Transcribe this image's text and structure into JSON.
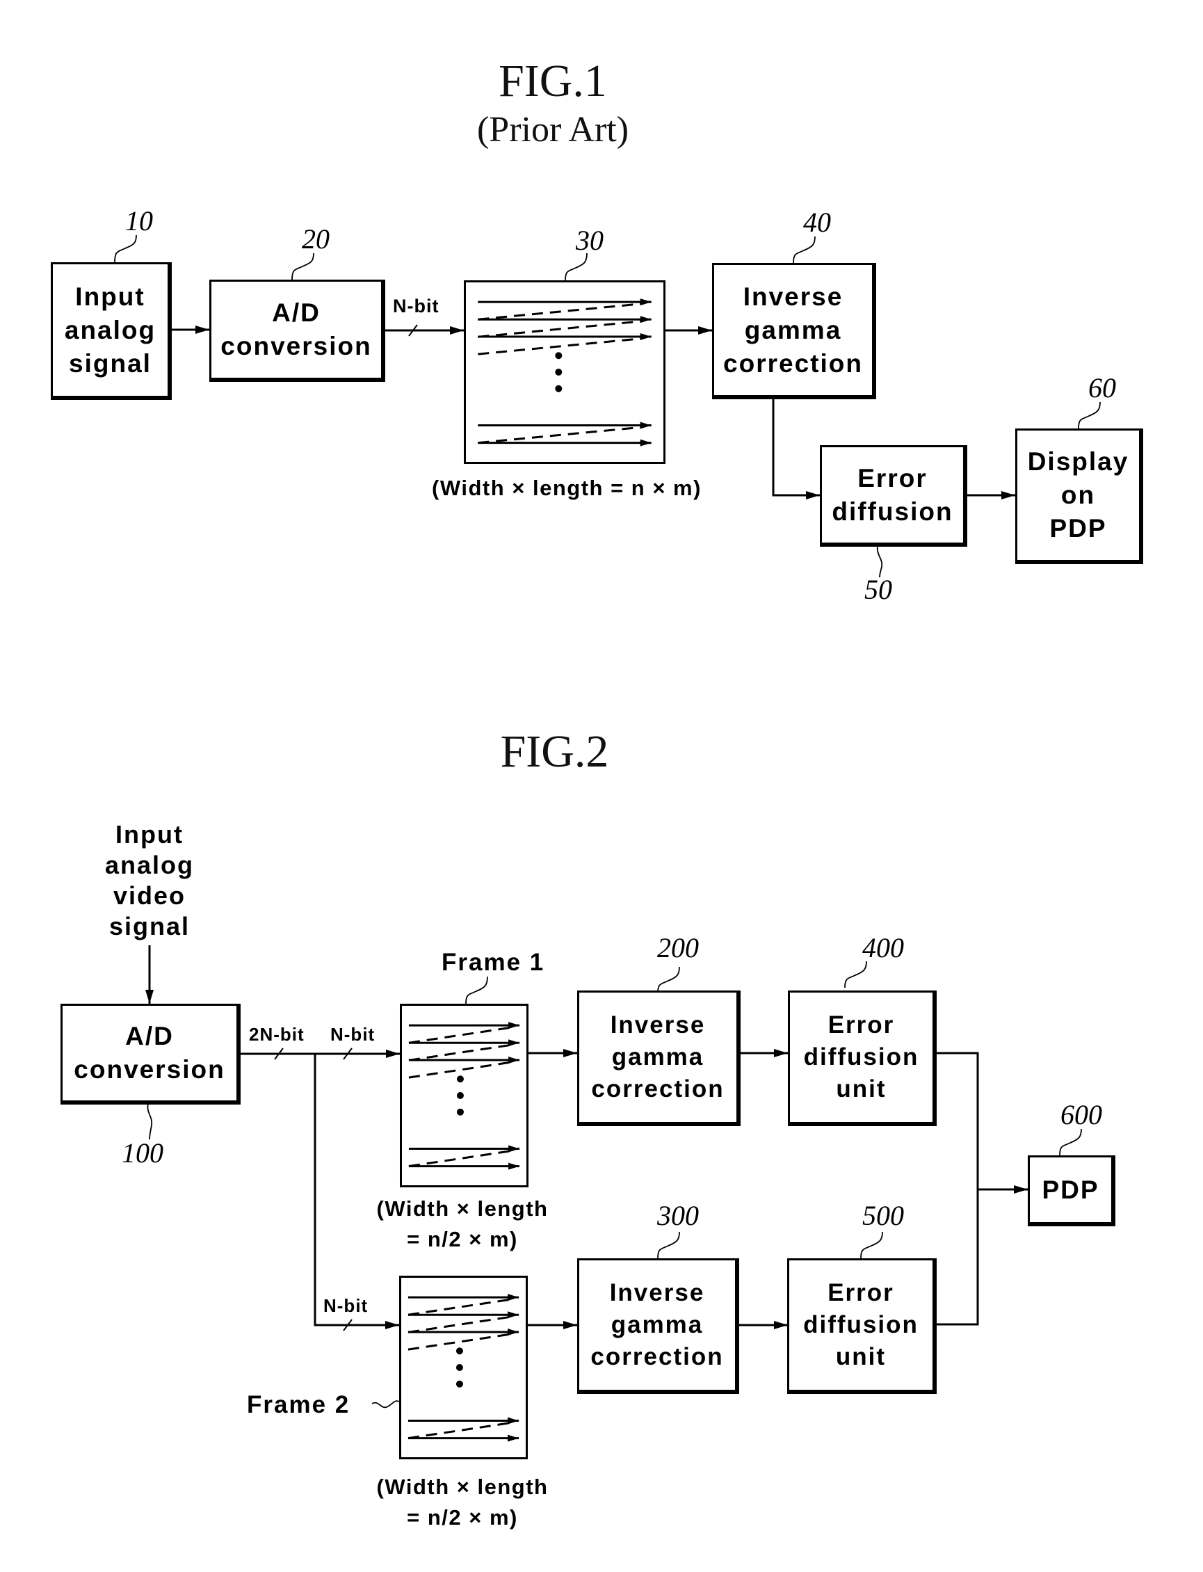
{
  "fig1": {
    "title": "FIG.1",
    "subtitle": "(Prior Art)",
    "blocks": [
      {
        "ref": "10",
        "label": "Input\nanalog\nsignal"
      },
      {
        "ref": "20",
        "label": "A/D\nconversion"
      },
      {
        "ref": "30",
        "label": ""
      },
      {
        "ref": "40",
        "label": "Inverse\ngamma\ncorrection"
      },
      {
        "ref": "50",
        "label": "Error\ndiffusion"
      },
      {
        "ref": "60",
        "label": "Display\non\nPDP"
      }
    ],
    "bus_label": "N-bit",
    "memory_caption": "(Width × length = n × m)"
  },
  "fig2": {
    "title": "FIG.2",
    "input_label": "Input\nanalog\nvideo\nsignal",
    "blocks": [
      {
        "ref": "100",
        "label": "A/D\nconversion"
      },
      {
        "ref": "200",
        "label": "Inverse\ngamma\ncorrection"
      },
      {
        "ref": "300",
        "label": "Inverse\ngamma\ncorrection"
      },
      {
        "ref": "400",
        "label": "Error\ndiffusion\nunit"
      },
      {
        "ref": "500",
        "label": "Error\ndiffusion\nunit"
      },
      {
        "ref": "600",
        "label": "PDP"
      }
    ],
    "bus_labels": {
      "main": "2N-bit",
      "upper": "N-bit",
      "lower": "N-bit"
    },
    "frames": [
      {
        "label": "Frame 1",
        "caption": "(Width × length\n= n/2 × m)"
      },
      {
        "label": "Frame 2",
        "caption": "(Width × length\n= n/2 × m)"
      }
    ]
  }
}
